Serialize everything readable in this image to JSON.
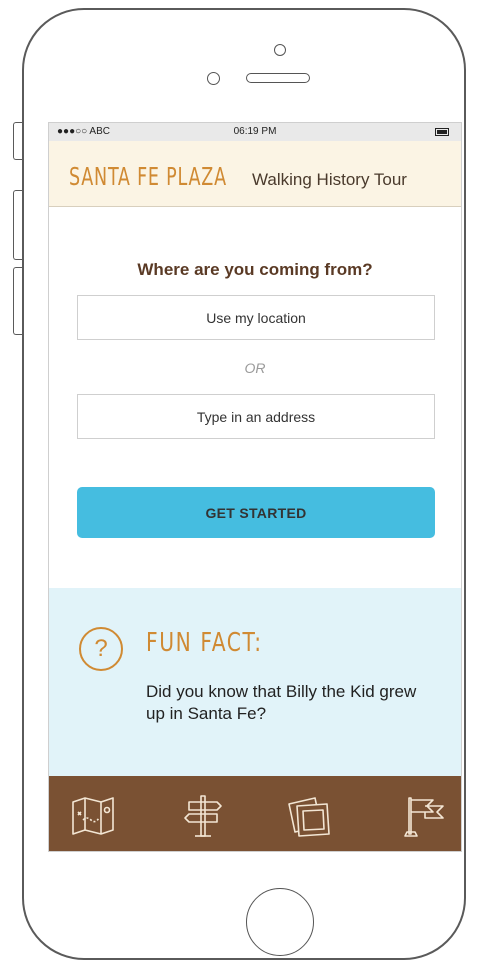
{
  "status_bar": {
    "carrier": "●●●○○ ABC",
    "time": "06:19 PM"
  },
  "header": {
    "title": "SANTA FE PLAZA",
    "subtitle": "Walking History Tour"
  },
  "main": {
    "question": "Where are you coming from?",
    "location_button": "Use my location",
    "or_label": "OR",
    "address_field": "Type in an address",
    "cta_label": "GET STARTED"
  },
  "fun_fact": {
    "title": "FUN FACT:",
    "icon_glyph": "?",
    "text": "Did you know that Billy the Kid grew up in Santa Fe?"
  },
  "tab_bar": {
    "items": [
      {
        "icon": "map-icon"
      },
      {
        "icon": "signpost-icon"
      },
      {
        "icon": "photos-icon"
      },
      {
        "icon": "flag-icon"
      }
    ]
  },
  "colors": {
    "accent_orange": "#d08a33",
    "button_blue": "#45bde0",
    "tab_brown": "#7a5133",
    "header_cream": "#fbf4e4",
    "funfact_blue": "#e1f3f9"
  }
}
